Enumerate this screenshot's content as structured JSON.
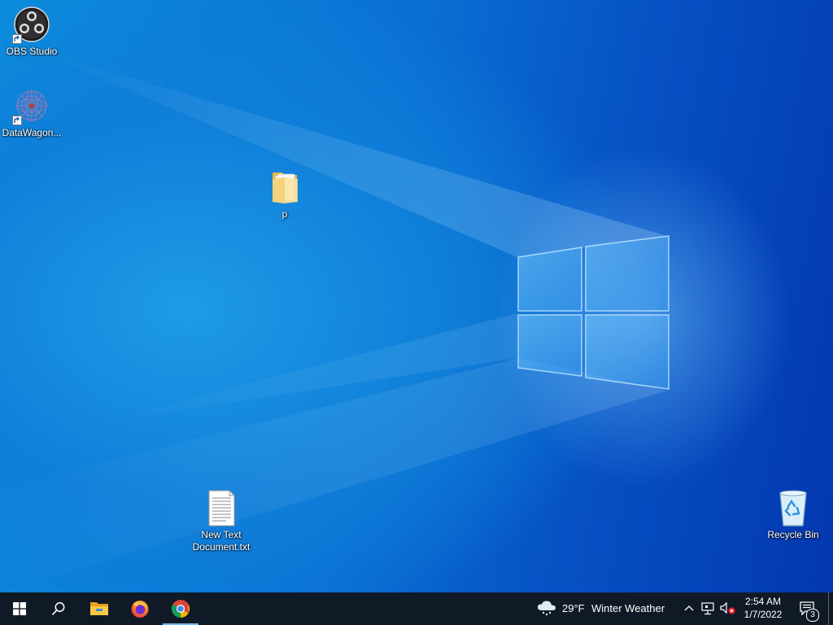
{
  "desktop": {
    "icons": [
      {
        "label": "OBS Studio",
        "icon": "obs-studio-icon",
        "shortcut": true
      },
      {
        "label": "DataWagon...",
        "icon": "datawagon-icon",
        "shortcut": true
      },
      {
        "label": "p",
        "icon": "folder-icon",
        "shortcut": false
      },
      {
        "label": "New Text Document.txt",
        "icon": "text-document-icon",
        "shortcut": false
      },
      {
        "label": "Recycle Bin",
        "icon": "recycle-bin-icon",
        "shortcut": false
      }
    ]
  },
  "taskbar": {
    "buttons": [
      {
        "name": "start",
        "icon": "windows-logo-icon"
      },
      {
        "name": "search",
        "icon": "search-icon"
      },
      {
        "name": "file-explorer",
        "icon": "file-explorer-icon"
      },
      {
        "name": "firefox",
        "icon": "firefox-icon"
      },
      {
        "name": "chrome",
        "icon": "chrome-icon",
        "active": true
      }
    ],
    "weather": {
      "icon": "cloud-snow-icon",
      "temperature": "29°F",
      "condition": "Winter Weather"
    },
    "tray": {
      "icons": [
        "chevron-up-icon",
        "network-icon",
        "volume-muted-icon"
      ]
    },
    "clock": {
      "time": "2:54 AM",
      "date": "1/7/2022"
    },
    "notifications": {
      "icon": "action-center-icon",
      "count": "3"
    }
  },
  "colors": {
    "taskbar_bg": "#101a27",
    "accent": "#76b9ed",
    "wallpaper_primary": "#0a6fd3"
  }
}
